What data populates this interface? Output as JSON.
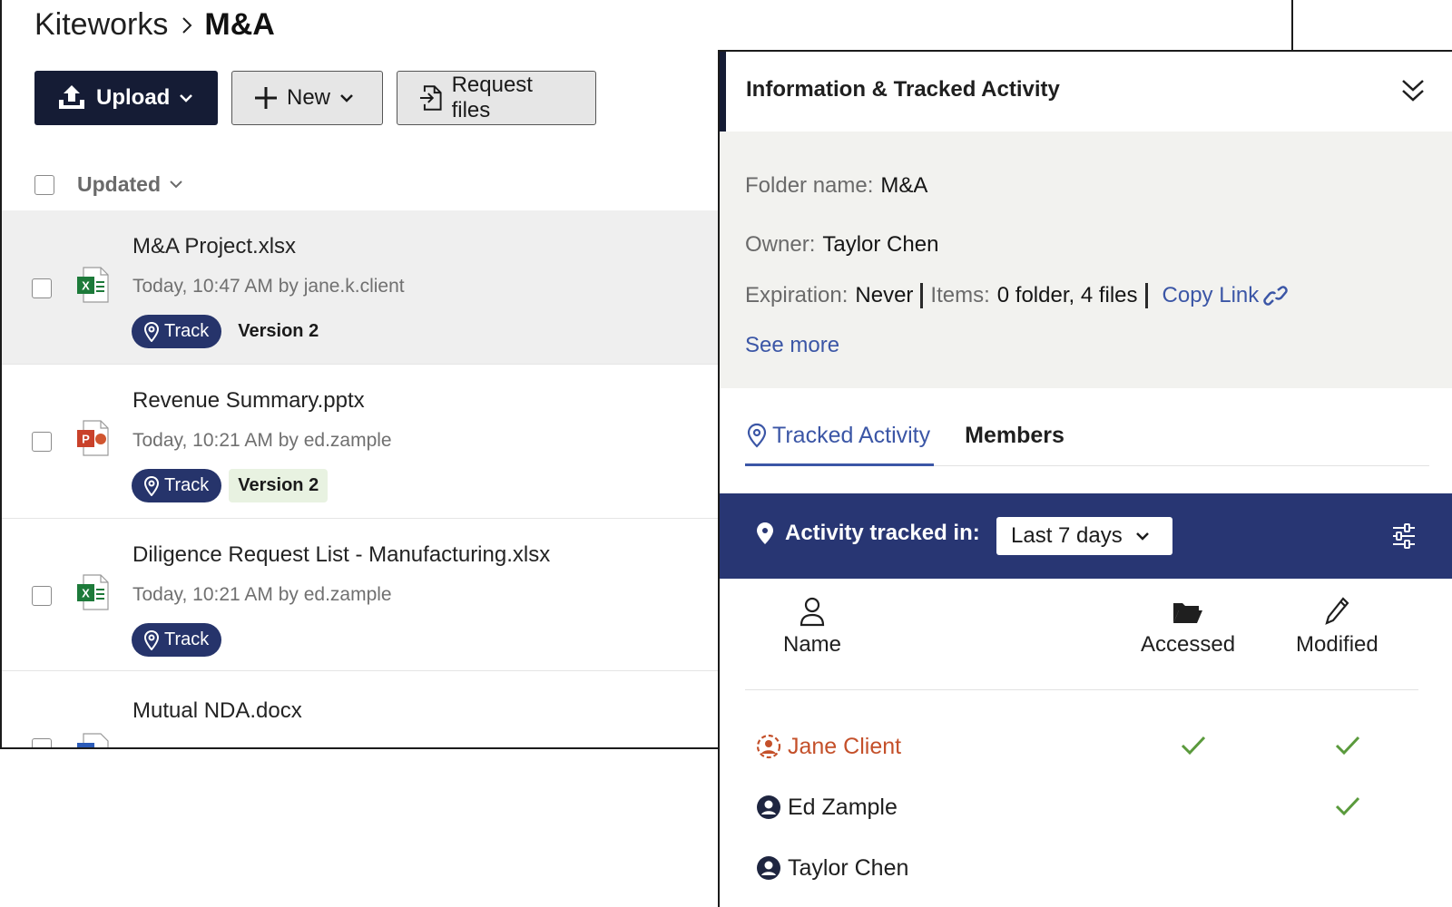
{
  "breadcrumb": {
    "root": "Kiteworks",
    "current": "M&A"
  },
  "toolbar": {
    "upload_label": "Upload",
    "new_label": "New",
    "request_label": "Request files"
  },
  "list": {
    "sort_label": "Updated",
    "files": [
      {
        "name": "M&A Project.xlsx",
        "meta": "Today, 10:47 AM by jane.k.client",
        "type": "excel",
        "track": "Track",
        "version": "Version 2"
      },
      {
        "name": "Revenue Summary.pptx",
        "meta": "Today, 10:21 AM by ed.zample",
        "type": "powerpoint",
        "track": "Track",
        "version": "Version 2"
      },
      {
        "name": "Diligence Request List - Manufacturing.xlsx",
        "meta": "Today, 10:21 AM by ed.zample",
        "type": "excel",
        "track": "Track"
      },
      {
        "name": "Mutual NDA.docx",
        "type": "word"
      }
    ]
  },
  "panel": {
    "title": "Information & Tracked Activity",
    "folder_label": "Folder name:",
    "folder_value": "M&A",
    "owner_label": "Owner:",
    "owner_value": "Taylor Chen",
    "expiration_label": "Expiration:",
    "expiration_value": "Never",
    "items_label": "Items:",
    "items_value": "0 folder, 4 files",
    "copy_link": "Copy Link",
    "see_more": "See more",
    "tabs": {
      "tracked": "Tracked Activity",
      "members": "Members"
    },
    "filter_label": "Activity tracked in:",
    "filter_value": "Last 7 days",
    "columns": {
      "name": "Name",
      "accessed": "Accessed",
      "modified": "Modified"
    },
    "members": [
      {
        "name": "Jane Client",
        "accessed": true,
        "modified": true
      },
      {
        "name": "Ed Zample",
        "accessed": false,
        "modified": true
      },
      {
        "name": "Taylor Chen",
        "accessed": false,
        "modified": false
      }
    ]
  },
  "colors": {
    "navy": "#151c35",
    "accent_blue": "#3b56a6",
    "filter_bar": "#283673",
    "check_green": "#5a9a3c",
    "highlight_user": "#c4502a"
  }
}
